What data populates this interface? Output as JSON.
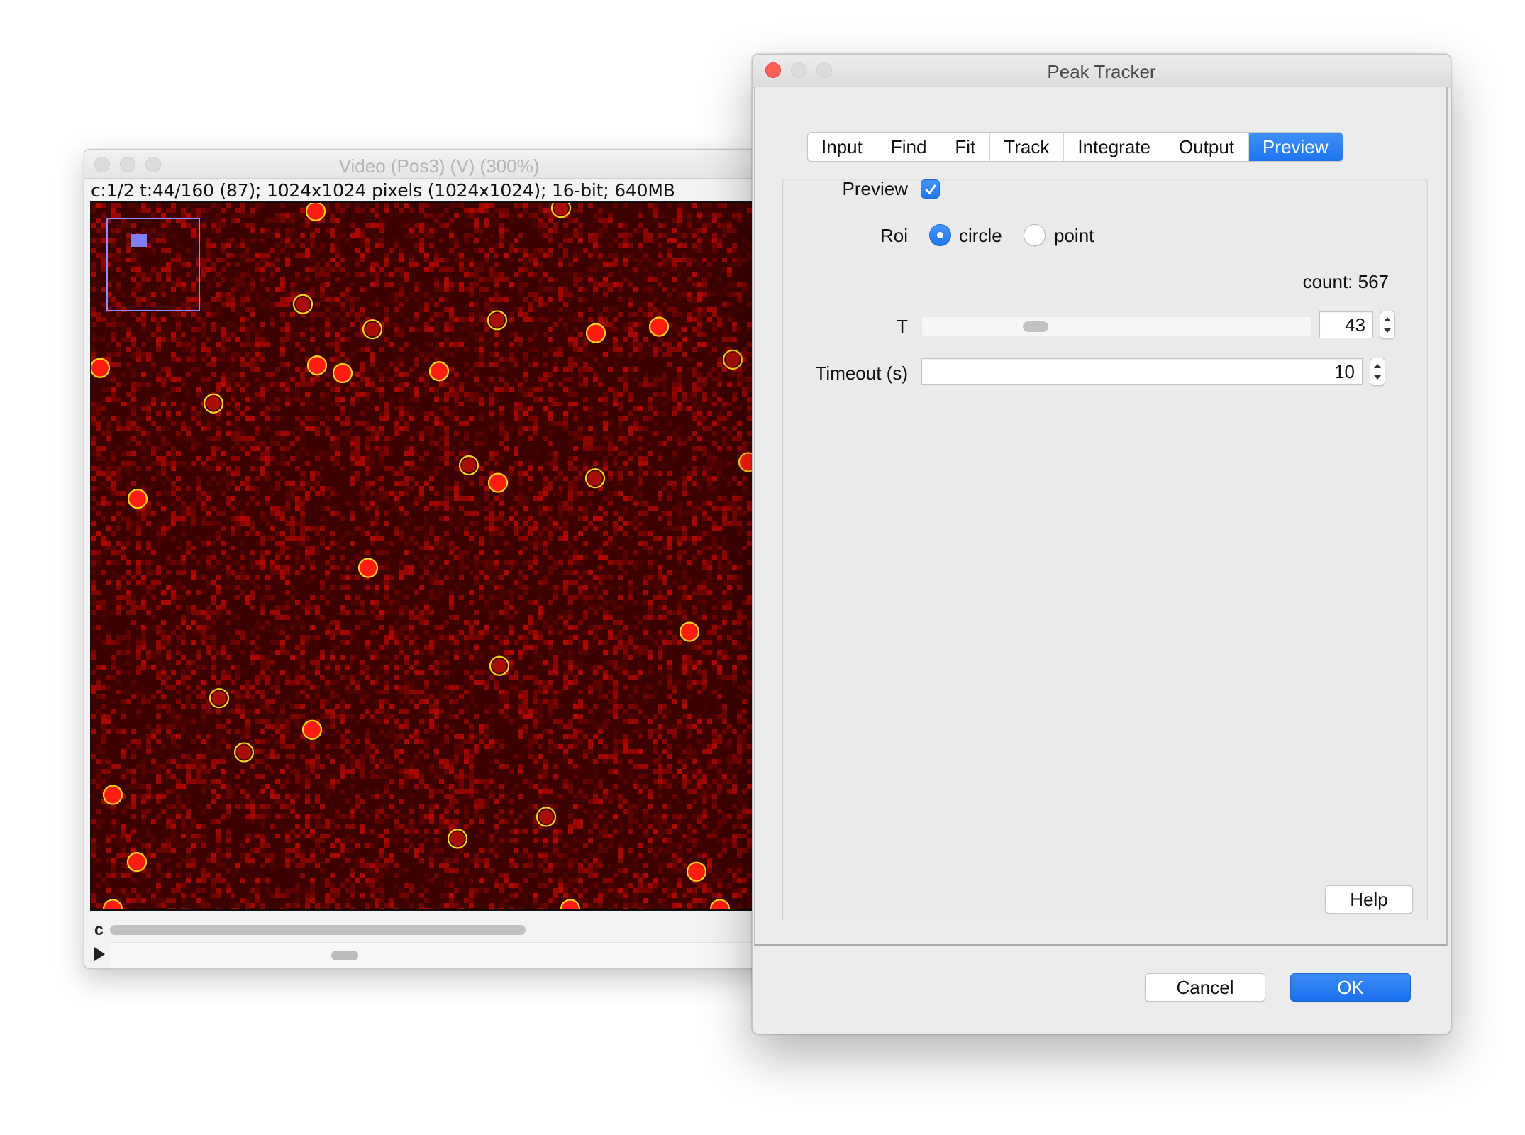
{
  "video_window": {
    "title": "Video (Pos3) (V) (300%)",
    "info": "c:1/2 t:44/160 (87); 1024x1024 pixels (1024x1024); 16-bit; 640MB",
    "channel_label": "c"
  },
  "dialog": {
    "title": "Peak Tracker",
    "tabs": [
      {
        "label": "Input"
      },
      {
        "label": "Find"
      },
      {
        "label": "Fit"
      },
      {
        "label": "Track"
      },
      {
        "label": "Integrate"
      },
      {
        "label": "Output"
      },
      {
        "label": "Preview"
      }
    ],
    "active_tab": "Preview",
    "preview": {
      "preview_label": "Preview",
      "preview_checked": true,
      "roi_label": "Roi",
      "roi_options": [
        "circle",
        "point"
      ],
      "roi_selected": "circle",
      "count_text": "count: 567",
      "t_label": "T",
      "t_value": "43",
      "timeout_label": "Timeout (s)",
      "timeout_value": "10"
    },
    "help_label": "Help",
    "cancel_label": "Cancel",
    "ok_label": "OK"
  },
  "colors": {
    "accent": "#1e75f0",
    "close_button": "#fe5f57",
    "peak_ring": "#f2d21b",
    "image_background": "#3d0000"
  }
}
